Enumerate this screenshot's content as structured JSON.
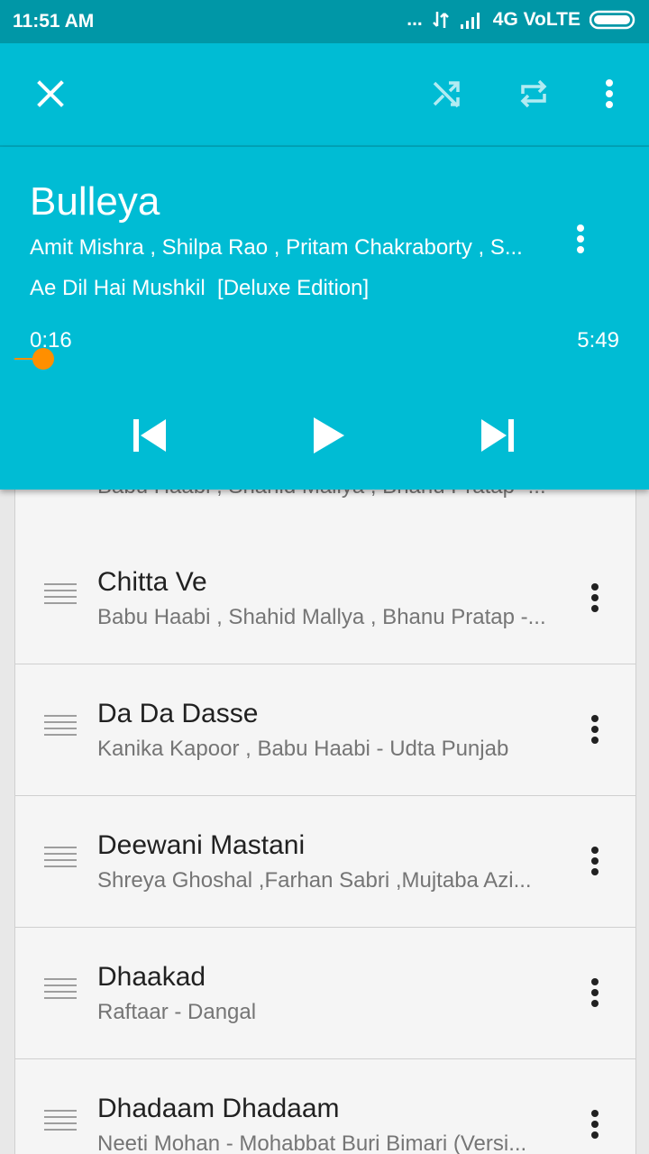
{
  "status_bar": {
    "time": "11:51 AM",
    "dots": "...",
    "network": "4G VoLTE"
  },
  "toolbar": {
    "close_icon": "close-icon",
    "shuffle_icon": "shuffle-icon",
    "repeat_icon": "repeat-icon",
    "menu_icon": "more-vert-icon"
  },
  "now_playing": {
    "title": "Bulleya",
    "artists": "Amit Mishra , Shilpa Rao , Pritam Chakraborty , S...",
    "album": "Ae Dil Hai Mushkil  [Deluxe Edition]",
    "elapsed": "0:16",
    "total": "5:49",
    "progress": 0.046,
    "accent_color": "#ff8f00"
  },
  "queue": {
    "partial_sub": "Babu Haabi , Shahid Mallya , Bhanu Pratap -...",
    "items": [
      {
        "title": "Chitta Ve",
        "subtitle": "Babu Haabi , Shahid Mallya , Bhanu Pratap -..."
      },
      {
        "title": "Da Da Dasse",
        "subtitle": "Kanika Kapoor , Babu Haabi - Udta Punjab"
      },
      {
        "title": "Deewani Mastani",
        "subtitle": "Shreya Ghoshal ,Farhan Sabri ,Mujtaba Azi..."
      },
      {
        "title": "Dhaakad",
        "subtitle": "Raftaar - Dangal"
      },
      {
        "title": "Dhadaam Dhadaam",
        "subtitle": "Neeti Mohan - Mohabbat Buri Bimari (Versi..."
      }
    ]
  },
  "colors": {
    "primary": "#00bcd4",
    "status": "#0097a7"
  }
}
